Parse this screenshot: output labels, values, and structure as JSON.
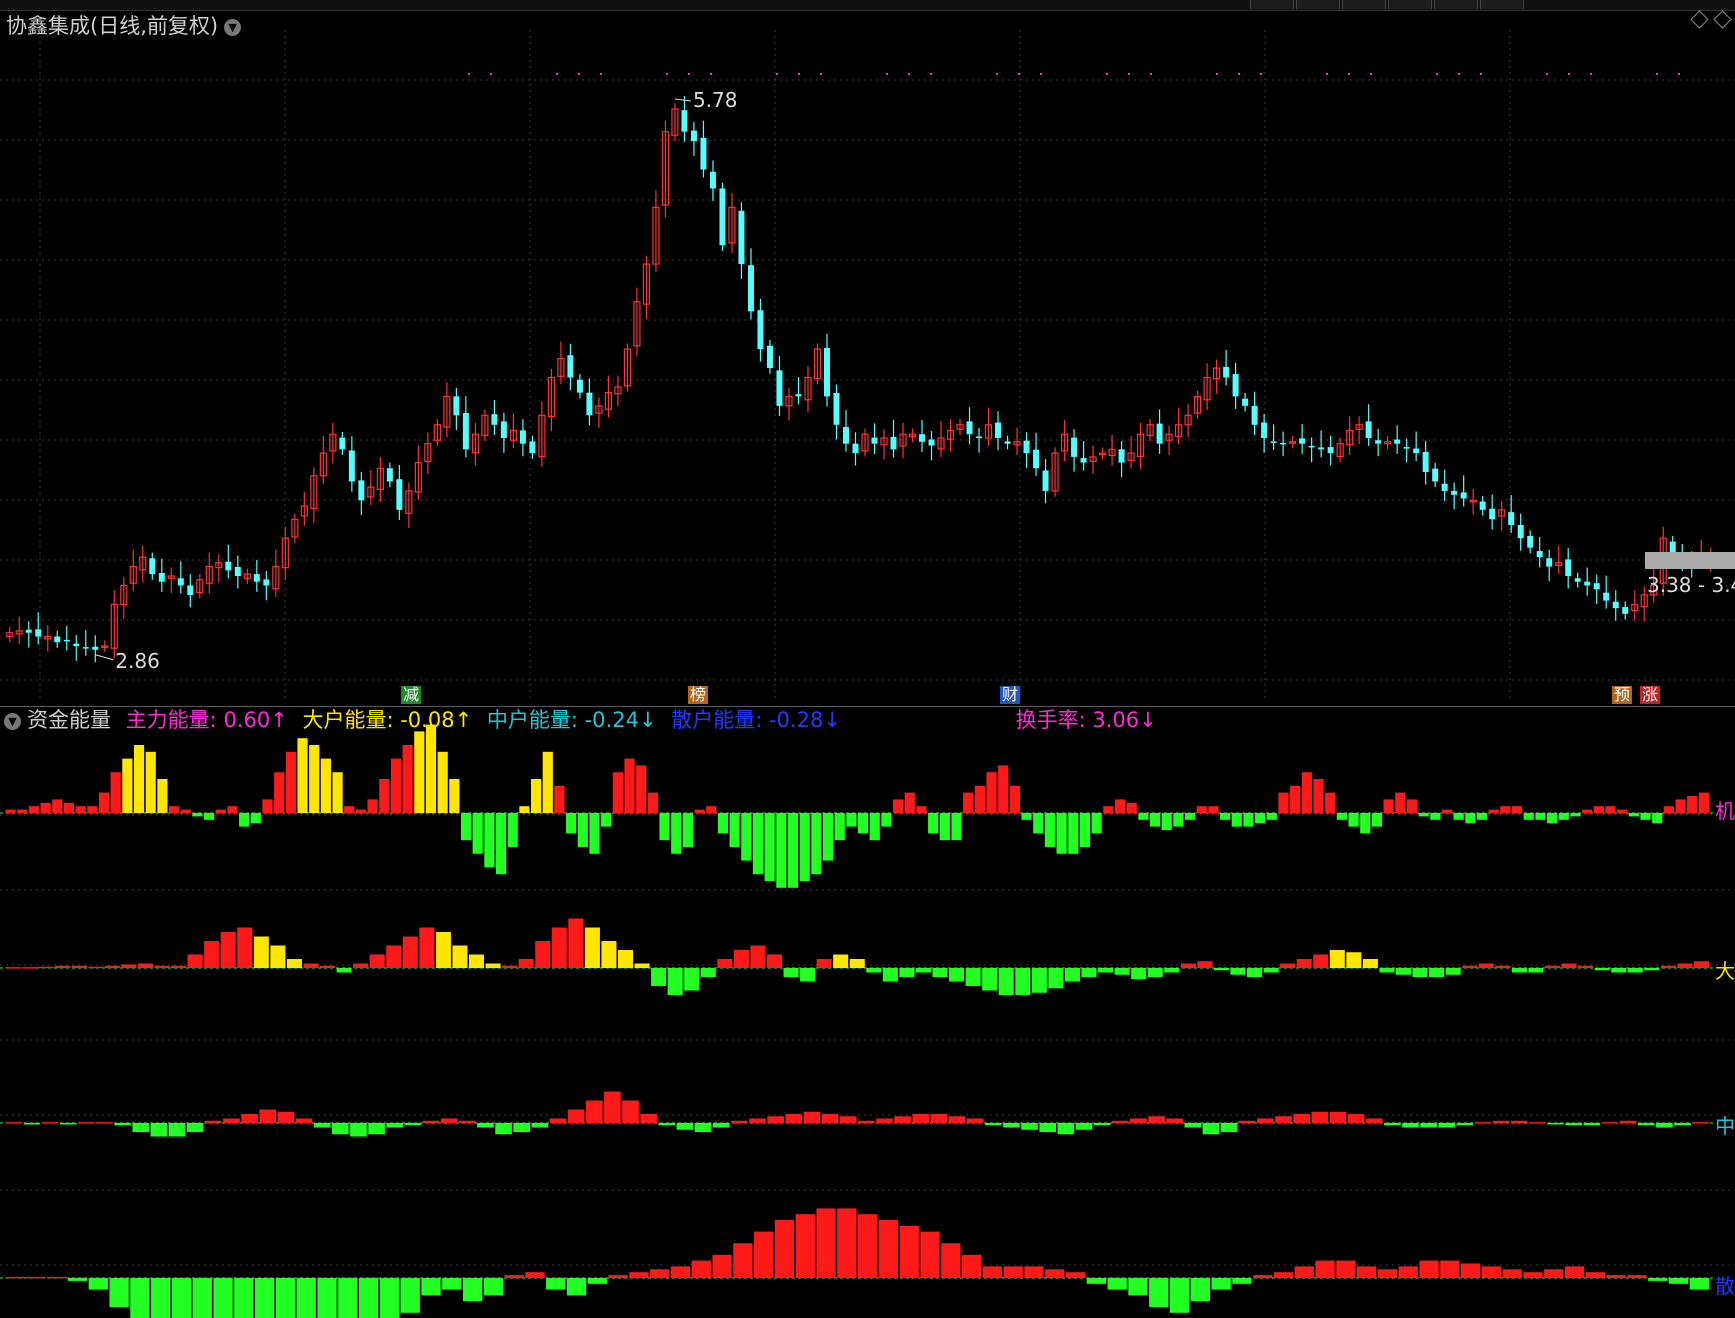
{
  "window": {
    "title": "协鑫集成(日线,前复权)"
  },
  "price_chart": {
    "high_label": "5.78",
    "low_label": "2.86",
    "range_label": "3.38 - 3.4"
  },
  "event_markers": [
    {
      "label": "减",
      "color": "#1f8a2a"
    },
    {
      "label": "榜",
      "color": "#b5651d"
    },
    {
      "label": "财",
      "color": "#2356c8"
    },
    {
      "label": "预",
      "color": "#b5651d"
    },
    {
      "label": "涨",
      "color": "#c0222a"
    }
  ],
  "indicator": {
    "name": "资金能量",
    "items": [
      {
        "label": "主力能量: 0.60↑",
        "color": "#ff2bd6"
      },
      {
        "label": "大户能量: -0.08↑",
        "color": "#ffe600"
      },
      {
        "label": "中户能量: -0.24↓",
        "color": "#22c7d8"
      },
      {
        "label": "散户能量: -0.28↓",
        "color": "#1b3cff"
      },
      {
        "label": "换手率: 3.06↓",
        "color": "#ff2bd6"
      }
    ],
    "right_labels": [
      {
        "label": "机",
        "color": "#ff2bd6"
      },
      {
        "label": "大",
        "color": "#ffe600"
      },
      {
        "label": "中",
        "color": "#22c7d8"
      },
      {
        "label": "散",
        "color": "#1b3cff"
      }
    ]
  },
  "colors": {
    "up": "#ff3232",
    "down": "#54ffff",
    "bar_pos": "#ff1a1a",
    "bar_pos_hi": "#ffe600",
    "bar_neg": "#22ff22",
    "grid": "#3a3a3a"
  },
  "chart_data": {
    "type": "candlestick_with_histograms",
    "price": {
      "ylim": [
        2.7,
        5.9
      ],
      "closes": [
        2.95,
        2.96,
        2.95,
        2.93,
        2.93,
        2.9,
        2.91,
        2.88,
        2.87,
        2.86,
        2.88,
        3.1,
        3.2,
        3.3,
        3.35,
        3.26,
        3.22,
        3.25,
        3.2,
        3.15,
        3.23,
        3.3,
        3.32,
        3.28,
        3.25,
        3.26,
        3.22,
        3.2,
        3.3,
        3.45,
        3.55,
        3.62,
        3.78,
        3.9,
        4.0,
        3.92,
        3.75,
        3.65,
        3.72,
        3.82,
        3.75,
        3.6,
        3.7,
        3.85,
        3.95,
        4.05,
        4.2,
        4.1,
        3.92,
        4.0,
        4.1,
        4.05,
        3.98,
        4.02,
        3.95,
        3.9,
        4.1,
        4.3,
        4.4,
        4.3,
        4.22,
        4.1,
        4.15,
        4.22,
        4.25,
        4.45,
        4.7,
        4.9,
        5.2,
        5.6,
        5.72,
        5.6,
        5.55,
        5.4,
        5.3,
        5.0,
        5.2,
        4.9,
        4.65,
        4.45,
        4.35,
        4.15,
        4.2,
        4.2,
        4.3,
        4.45,
        4.2,
        4.05,
        3.95,
        3.9,
        4.0,
        3.95,
        3.98,
        3.92,
        4.0,
        4.0,
        3.96,
        3.94,
        3.98,
        4.02,
        4.05,
        4.0,
        3.98,
        4.05,
        3.98,
        3.95,
        3.96,
        3.9,
        3.82,
        3.7,
        3.9,
        4.0,
        3.88,
        3.85,
        3.88,
        3.9,
        3.92,
        3.85,
        3.9,
        4.0,
        4.05,
        3.95,
        4.0,
        4.05,
        4.1,
        4.2,
        4.3,
        4.35,
        4.3,
        4.2,
        4.15,
        4.05,
        3.98,
        3.96,
        3.95,
        3.96,
        3.95,
        3.93,
        3.92,
        3.9,
        3.95,
        4.02,
        4.05,
        3.98,
        3.95,
        3.96,
        3.95,
        3.93,
        3.9,
        3.8,
        3.75,
        3.7,
        3.68,
        3.66,
        3.65,
        3.6,
        3.55,
        3.6,
        3.52,
        3.45,
        3.4,
        3.35,
        3.3,
        3.32,
        3.25,
        3.22,
        3.2,
        3.18,
        3.12,
        3.08,
        3.05,
        3.1,
        3.15,
        3.2,
        3.45,
        3.35,
        3.33,
        3.32,
        3.35,
        3.34,
        3.33
      ],
      "high_point": {
        "label": "5.78"
      },
      "low_point": {
        "label": "2.86"
      }
    },
    "histograms": [
      {
        "name": "机",
        "values": [
          0.05,
          0.05,
          0.1,
          0.15,
          0.2,
          0.15,
          0.1,
          0.1,
          0.3,
          0.6,
          0.8,
          1.0,
          0.9,
          0.5,
          0.1,
          0.05,
          -0.05,
          -0.1,
          0.05,
          0.1,
          -0.2,
          -0.15,
          0.2,
          0.6,
          0.9,
          1.1,
          1.0,
          0.8,
          0.6,
          0.1,
          0.05,
          0.2,
          0.5,
          0.8,
          1.0,
          1.2,
          1.3,
          0.9,
          0.5,
          -0.4,
          -0.6,
          -0.8,
          -0.9,
          -0.5,
          0.1,
          0.5,
          0.9,
          0.4,
          -0.3,
          -0.5,
          -0.6,
          -0.2,
          0.6,
          0.8,
          0.7,
          0.3,
          -0.4,
          -0.6,
          -0.5,
          0.05,
          0.1,
          -0.3,
          -0.5,
          -0.7,
          -0.9,
          -1.0,
          -1.1,
          -1.1,
          -1.0,
          -0.9,
          -0.7,
          -0.4,
          -0.2,
          -0.3,
          -0.4,
          -0.2,
          0.2,
          0.3,
          0.1,
          -0.3,
          -0.4,
          -0.4,
          0.3,
          0.4,
          0.6,
          0.7,
          0.4,
          -0.1,
          -0.3,
          -0.5,
          -0.6,
          -0.6,
          -0.5,
          -0.3,
          0.1,
          0.2,
          0.15,
          -0.1,
          -0.2,
          -0.25,
          -0.2,
          -0.1,
          0.1,
          0.1,
          -0.1,
          -0.2,
          -0.2,
          -0.15,
          -0.1,
          0.3,
          0.4,
          0.6,
          0.5,
          0.3,
          -0.1,
          -0.2,
          -0.3,
          -0.2,
          0.2,
          0.3,
          0.2,
          -0.05,
          -0.1,
          0.05,
          -0.1,
          -0.15,
          -0.1,
          0.05,
          0.1,
          0.1,
          -0.1,
          -0.1,
          -0.15,
          -0.1,
          -0.05,
          0.05,
          0.1,
          0.1,
          0.05,
          -0.05,
          -0.1,
          -0.15,
          0.1,
          0.2,
          0.25,
          0.3
        ],
        "pos_hi_ranges": [
          [
            10,
            13
          ],
          [
            25,
            28
          ],
          [
            35,
            38
          ],
          [
            44,
            46
          ],
          [
            49,
            51
          ]
        ]
      },
      {
        "name": "大",
        "values": [
          0.02,
          0.02,
          0.03,
          0.05,
          0.05,
          0.03,
          0.05,
          0.08,
          0.1,
          0.05,
          0.05,
          0.3,
          0.6,
          0.8,
          0.9,
          0.7,
          0.5,
          0.2,
          0.1,
          0.05,
          -0.1,
          0.1,
          0.3,
          0.5,
          0.7,
          0.9,
          0.8,
          0.5,
          0.3,
          0.1,
          0.05,
          0.2,
          0.6,
          0.9,
          1.1,
          0.9,
          0.6,
          0.4,
          0.1,
          -0.4,
          -0.6,
          -0.5,
          -0.2,
          0.2,
          0.4,
          0.5,
          0.3,
          -0.2,
          -0.3,
          0.2,
          0.3,
          0.2,
          -0.1,
          -0.3,
          -0.2,
          -0.1,
          -0.2,
          -0.3,
          -0.4,
          -0.5,
          -0.6,
          -0.6,
          -0.55,
          -0.45,
          -0.3,
          -0.2,
          -0.1,
          -0.15,
          -0.25,
          -0.2,
          -0.1,
          0.1,
          0.15,
          -0.05,
          -0.15,
          -0.2,
          -0.1,
          0.1,
          0.2,
          0.3,
          0.4,
          0.35,
          0.2,
          -0.1,
          -0.15,
          -0.2,
          -0.2,
          -0.15,
          0.05,
          0.1,
          0.05,
          -0.1,
          -0.1,
          0.05,
          0.1,
          0.05,
          -0.05,
          -0.1,
          -0.1,
          -0.05,
          0.05,
          0.1,
          0.15
        ],
        "pos_hi_ranges": [
          [
            15,
            17
          ],
          [
            26,
            29
          ],
          [
            35,
            39
          ],
          [
            50,
            52
          ],
          [
            80,
            82
          ]
        ]
      },
      {
        "name": "中",
        "values": [
          0.02,
          -0.02,
          0.02,
          -0.03,
          0.02,
          0.02,
          -0.05,
          -0.2,
          -0.3,
          -0.3,
          -0.2,
          0.05,
          0.1,
          0.2,
          0.3,
          0.25,
          0.1,
          -0.1,
          -0.25,
          -0.3,
          -0.25,
          -0.1,
          -0.05,
          0.05,
          0.1,
          0.05,
          -0.1,
          -0.25,
          -0.2,
          -0.1,
          0.1,
          0.3,
          0.5,
          0.7,
          0.5,
          0.2,
          -0.05,
          -0.15,
          -0.2,
          -0.1,
          0.05,
          0.1,
          0.15,
          0.2,
          0.25,
          0.2,
          0.15,
          0.05,
          0.1,
          0.15,
          0.2,
          0.2,
          0.15,
          0.1,
          -0.05,
          -0.1,
          -0.15,
          -0.2,
          -0.25,
          -0.15,
          -0.05,
          0.05,
          0.1,
          0.15,
          0.1,
          -0.1,
          -0.25,
          -0.2,
          0.05,
          0.1,
          0.15,
          0.2,
          0.25,
          0.25,
          0.2,
          0.1,
          -0.05,
          -0.1,
          -0.1,
          -0.1,
          -0.05,
          0.02,
          0.05,
          0.05,
          0.02,
          -0.03,
          -0.05,
          -0.05,
          0.02,
          0.05,
          -0.05,
          -0.1,
          -0.05,
          0.02
        ]
      },
      {
        "name": "散",
        "values": [
          0.02,
          0.02,
          0.02,
          -0.05,
          -0.2,
          -0.5,
          -0.8,
          -0.9,
          -0.9,
          -0.8,
          -0.9,
          -1.0,
          -1.0,
          -0.9,
          -0.8,
          -0.9,
          -1.0,
          -1.0,
          -0.8,
          -0.6,
          -0.3,
          -0.2,
          -0.4,
          -0.3,
          0.05,
          0.1,
          -0.2,
          -0.3,
          -0.1,
          0.05,
          0.1,
          0.15,
          0.2,
          0.3,
          0.4,
          0.6,
          0.8,
          1.0,
          1.1,
          1.2,
          1.2,
          1.1,
          1.0,
          0.9,
          0.8,
          0.6,
          0.4,
          0.2,
          0.2,
          0.2,
          0.15,
          0.1,
          -0.1,
          -0.2,
          -0.3,
          -0.5,
          -0.6,
          -0.4,
          -0.2,
          -0.1,
          0.05,
          0.1,
          0.2,
          0.3,
          0.3,
          0.2,
          0.15,
          0.2,
          0.3,
          0.3,
          0.25,
          0.2,
          0.15,
          0.1,
          0.15,
          0.2,
          0.1,
          0.05,
          0.05,
          -0.05,
          -0.1,
          -0.2
        ]
      }
    ]
  }
}
